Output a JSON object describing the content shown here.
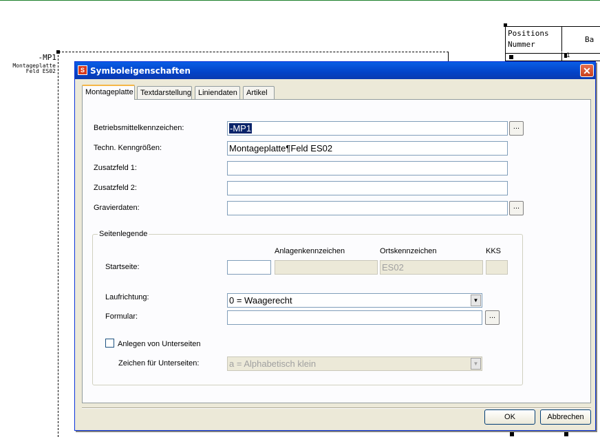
{
  "cad": {
    "device_label": "-MP1",
    "device_sublabel_line1": "Montageplatte",
    "device_sublabel_line2": "Feld ES02",
    "position_header_line1": "Positions",
    "position_header_line2": "Nummer",
    "column_header_partial": "Ba",
    "row_value": "1"
  },
  "dialog": {
    "title": "Symboleigenschaften",
    "tabs": [
      {
        "label": "Montageplatte",
        "active": true
      },
      {
        "label": "Textdarstellung",
        "active": false
      },
      {
        "label": "Liniendaten",
        "active": false
      },
      {
        "label": "Artikel",
        "active": false
      }
    ],
    "fields": {
      "bmk_label": "Betriebsmittelkennzeichen:",
      "bmk_value": "-MP1",
      "kenngroessen_label": "Techn. Kenngrößen:",
      "kenngroessen_value": "Montageplatte¶Feld ES02",
      "zusatz1_label": "Zusatzfeld 1:",
      "zusatz1_value": "",
      "zusatz2_label": "Zusatzfeld 2:",
      "zusatz2_value": "",
      "gravur_label": "Gravierdaten:",
      "gravur_value": "",
      "browse_label": "..."
    },
    "seitenlegende": {
      "title": "Seitenlegende",
      "col_anlage": "Anlagenkennzeichen",
      "col_ort": "Ortskennzeichen",
      "col_kks": "KKS",
      "startseite_label": "Startseite:",
      "startseite_value": "",
      "anlage_value": "",
      "ort_value": "ES02",
      "kks_value": "",
      "laufrichtung_label": "Laufrichtung:",
      "laufrichtung_value": "0 = Waagerecht",
      "formular_label": "Formular:",
      "formular_value": "",
      "unterseiten_label": "Anlegen von Unterseiten",
      "unterseiten_checked": false,
      "zeichen_label": "Zeichen für Unterseiten:",
      "zeichen_value": "a = Alphabetisch klein"
    },
    "buttons": {
      "ok": "OK",
      "cancel": "Abbrechen"
    },
    "close_symbol": "✕"
  }
}
